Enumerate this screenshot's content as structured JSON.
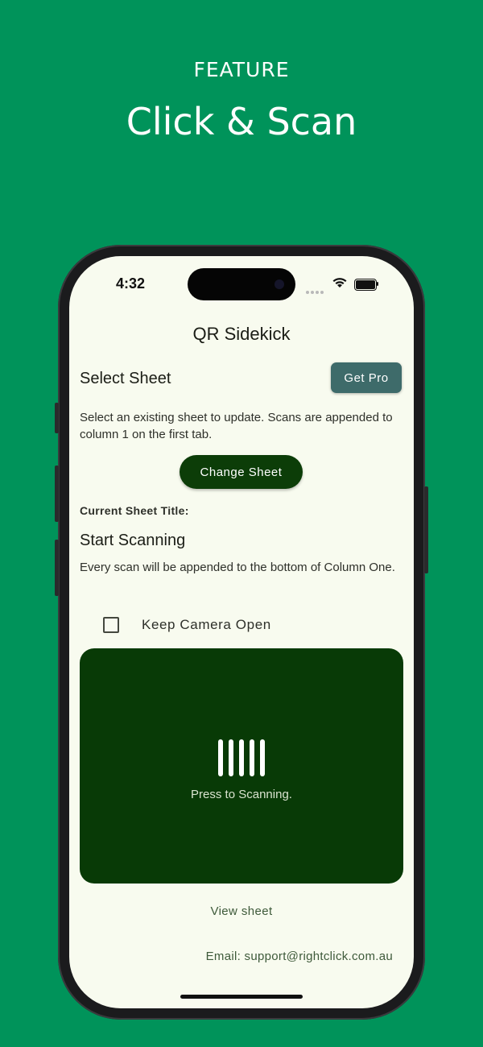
{
  "promo": {
    "label": "FEATURE",
    "title": "Click & Scan"
  },
  "status_bar": {
    "time": "4:32",
    "icons": [
      "signal-dots-icon",
      "wifi-icon",
      "battery-icon"
    ]
  },
  "app": {
    "title": "QR Sidekick",
    "select_sheet": {
      "heading": "Select Sheet",
      "get_pro_label": "Get Pro",
      "description": "Select an existing sheet to update. Scans are appended to column 1 on the first tab.",
      "change_sheet_label": "Change Sheet",
      "current_sheet_label": "Current Sheet Title:"
    },
    "start_scanning": {
      "heading": "Start Scanning",
      "description": "Every scan will be appended to the bottom of Column One.",
      "keep_camera_label": "Keep Camera Open",
      "keep_camera_checked": false,
      "scan_prompt": "Press to Scanning.",
      "scan_icon": "barcode-icon"
    },
    "view_sheet_label": "View sheet",
    "email_text": "Email: support@rightclick.com.au"
  },
  "colors": {
    "background": "#00935a",
    "screen": "#f8fbef",
    "get_pro": "#3e6b6a",
    "change_sheet": "#0c3d08",
    "scan_panel": "#083a06"
  }
}
